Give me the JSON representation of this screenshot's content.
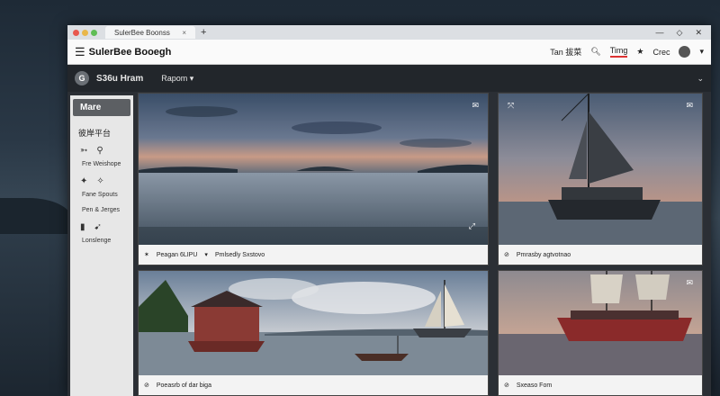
{
  "browser": {
    "tab_label": "SulerBee Boonss",
    "tab_close": "×",
    "new_tab": "+",
    "window_controls": [
      "—",
      "◇",
      "✕"
    ]
  },
  "appbar": {
    "title": "SulerBee Booegh",
    "right_items": [
      "Tan 拔菜",
      "Timg",
      "Crec"
    ]
  },
  "subbar": {
    "logo_letter": "G",
    "title": "S36u Hram",
    "menu": "Rapom ▾",
    "chevron": "⌄"
  },
  "sidebar": {
    "header": "Mare",
    "category": "彼岸平台",
    "items": [
      "Fre Weishope",
      "Fane Spouts",
      "Pen & Jerges",
      "Lonslenge"
    ]
  },
  "cards": [
    {
      "caption_left": "Peagan 6LIPU",
      "caption_mid": "Pmlsedly Sxstovo",
      "caption_dropdown": "▾"
    },
    {
      "caption_left": "Pmrasby agtvotnao"
    },
    {
      "caption_left": "Poeasrb of dar biga"
    },
    {
      "caption_left": "Sxeaso Fom"
    }
  ],
  "colors": {
    "tab_red": "#e8584e",
    "tab_yellow": "#e9b74a",
    "tab_green": "#5fbd55",
    "accent_underline": "#dd3333"
  }
}
